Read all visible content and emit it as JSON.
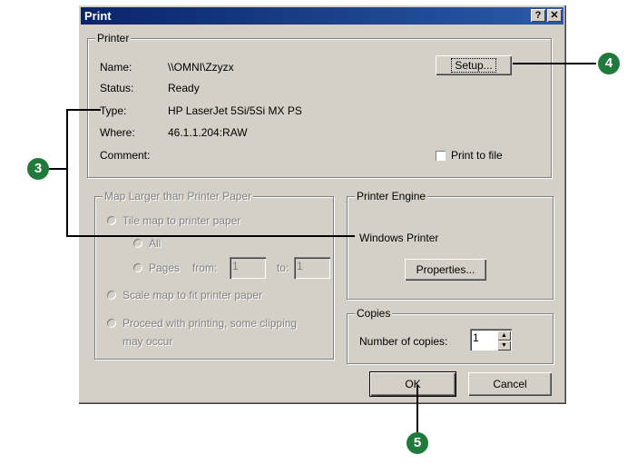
{
  "dialog": {
    "title": "Print",
    "help_btn": "?",
    "close_btn": "✕"
  },
  "printer": {
    "legend": "Printer",
    "name_label": "Name:",
    "name_value": "\\\\OMNI\\Zzyzx",
    "status_label": "Status:",
    "status_value": "Ready",
    "type_label": "Type:",
    "type_value": "HP LaserJet 5Si/5Si MX PS",
    "where_label": "Where:",
    "where_value": "46.1.1.204:RAW",
    "comment_label": "Comment:",
    "setup_button": "Setup...",
    "print_to_file": "Print to file",
    "print_to_file_checked": false
  },
  "map_larger": {
    "legend": "Map Larger than Printer Paper",
    "tile": "Tile map to printer paper",
    "all": "All",
    "pages": "Pages",
    "from_label": "from:",
    "from_value": "1",
    "to_label": "to:",
    "to_value": "1",
    "scale": "Scale map to fit printer paper",
    "proceed_line1": "Proceed with printing, some clipping",
    "proceed_line2": "may occur"
  },
  "engine": {
    "legend": "Printer Engine",
    "value": "Windows Printer",
    "properties_button": "Properties..."
  },
  "copies": {
    "legend": "Copies",
    "label": "Number of copies:",
    "value": "1"
  },
  "buttons": {
    "ok": "OK",
    "cancel": "Cancel"
  },
  "callouts": {
    "three": "3",
    "four": "4",
    "five": "5"
  },
  "colors": {
    "title_bar": "#0a246a",
    "dialog_face": "#d4d0c8",
    "callout": "#1f7a3b"
  }
}
